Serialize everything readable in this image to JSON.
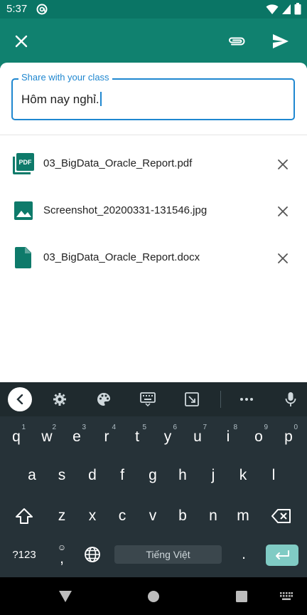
{
  "status_bar": {
    "time": "5:37",
    "icons": [
      "at-sign-icon",
      "wifi-icon",
      "signal-icon",
      "battery-icon"
    ]
  },
  "app_bar": {
    "close_icon": "close-icon",
    "attach_icon": "paperclip-icon",
    "send_icon": "send-icon"
  },
  "compose": {
    "label": "Share with your class",
    "value": "Hôm nay nghỉ."
  },
  "attachments": [
    {
      "name": "03_BigData_Oracle_Report.pdf",
      "icon": "pdf-icon"
    },
    {
      "name": "Screenshot_20200331-131546.jpg",
      "icon": "image-icon"
    },
    {
      "name": "03_BigData_Oracle_Report.docx",
      "icon": "document-icon"
    }
  ],
  "keyboard": {
    "toolbar_icons": [
      "back-icon",
      "gear-icon",
      "palette-icon",
      "keyboard-icon",
      "resize-icon",
      "more-icon",
      "mic-icon"
    ],
    "row1": [
      {
        "key": "q",
        "hint": "1"
      },
      {
        "key": "w",
        "hint": "2"
      },
      {
        "key": "e",
        "hint": "3"
      },
      {
        "key": "r",
        "hint": "4"
      },
      {
        "key": "t",
        "hint": "5"
      },
      {
        "key": "y",
        "hint": "6"
      },
      {
        "key": "u",
        "hint": "7"
      },
      {
        "key": "i",
        "hint": "8"
      },
      {
        "key": "o",
        "hint": "9"
      },
      {
        "key": "p",
        "hint": "0"
      }
    ],
    "row2": [
      "a",
      "s",
      "d",
      "f",
      "g",
      "h",
      "j",
      "k",
      "l"
    ],
    "row3": [
      "z",
      "x",
      "c",
      "v",
      "b",
      "n",
      "m"
    ],
    "symbols_key": "?123",
    "comma_key": ",",
    "period_key": ".",
    "space_label": "Tiếng Việt",
    "accent_color": "#80cbc4"
  },
  "colors": {
    "primary": "#10816f",
    "status_bar": "#0a7565",
    "focus": "#1f87d0"
  }
}
